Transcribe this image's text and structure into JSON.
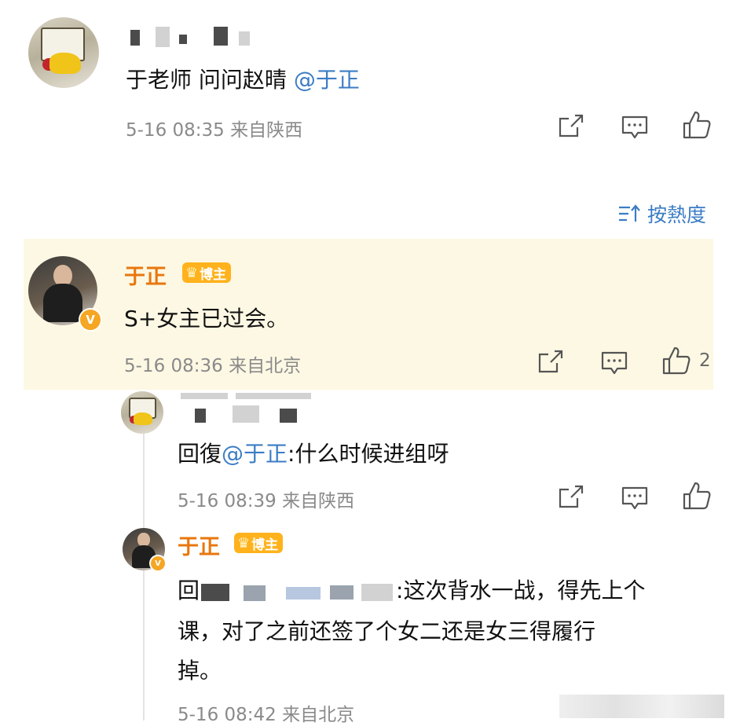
{
  "comment1": {
    "text": "于老师 问问赵晴",
    "mention": "@于正",
    "time": "5-16 08:35",
    "location": "来自陕西"
  },
  "sort": {
    "icon": "sort-icon",
    "label": "按熱度"
  },
  "comment2": {
    "author": "于正",
    "badge": "博主",
    "text": "S+女主已过会。",
    "time": "5-16 08:36",
    "location": "来自北京",
    "like_count": "2",
    "verified_icon": "v-badge-icon",
    "highlight_color": "#fdf8e3"
  },
  "reply1": {
    "prefix": "回復",
    "mention": "@于正",
    "text": ":什么时候进组呀",
    "time": "5-16 08:39",
    "location": "来自陕西"
  },
  "reply2": {
    "author": "于正",
    "badge": "博主",
    "text_line1_prefix": "回",
    "text_line1": ":这次背水一战，得先上个",
    "text_line2": "课，对了之前还签了个女二还是女三得履行",
    "text_line3": "掉。",
    "time": "5-16 08:42",
    "location": "来自北京"
  },
  "colors": {
    "accent": "#e8770e",
    "mention": "#3b7cc4",
    "meta": "#8a8a8a",
    "badge": "#ffb21c"
  }
}
